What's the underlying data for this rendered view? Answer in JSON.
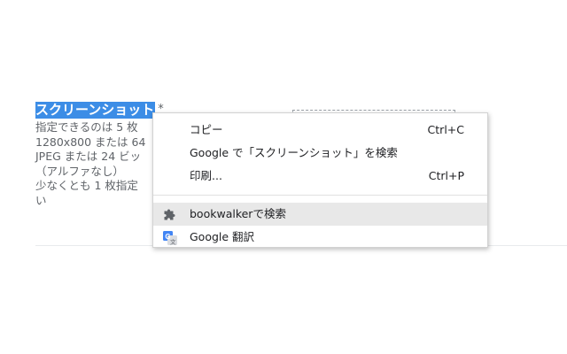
{
  "form": {
    "heading_selected": "スクリーンショット",
    "required_mark": "*",
    "help_lines": [
      "指定できるのは 5 枚",
      "1280x800 または 64",
      "JPEG または 24 ビッ",
      "（アルファなし）",
      "少なくとも 1 枚指定",
      "い"
    ]
  },
  "context_menu": {
    "items": [
      {
        "label": "コピー",
        "shortcut": "Ctrl+C"
      },
      {
        "label": "Google で「スクリーンショット」を検索",
        "shortcut": ""
      },
      {
        "label": "印刷...",
        "shortcut": "Ctrl+P"
      }
    ],
    "extension_items": [
      {
        "label": "bookwalkerで検索",
        "icon": "puzzle-icon"
      },
      {
        "label": "Google 翻訳",
        "icon": "google-translate-icon"
      }
    ]
  },
  "colors": {
    "selection": "#3c8de6",
    "hover": "#e8e8e8",
    "translate_blue": "#4285f4"
  }
}
